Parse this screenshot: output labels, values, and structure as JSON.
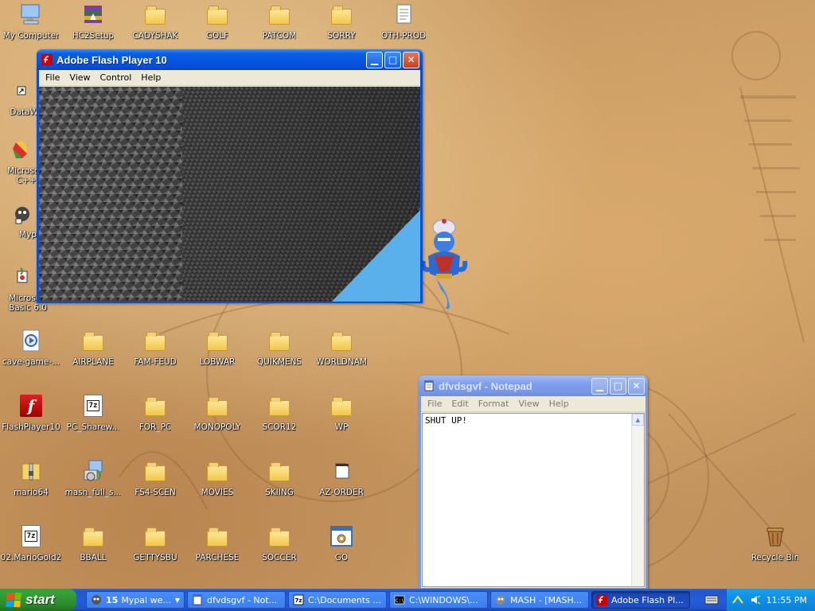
{
  "desktop": {
    "icons": [
      {
        "label": "My Computer",
        "icon": "computer-icon"
      },
      {
        "label": "HC2Setup",
        "icon": "archive-installer-icon"
      },
      {
        "label": "CADYSHAK",
        "icon": "folder-icon"
      },
      {
        "label": "GOLF",
        "icon": "folder-icon"
      },
      {
        "label": "PATCOM",
        "icon": "folder-icon"
      },
      {
        "label": "SORRY",
        "icon": "folder-icon"
      },
      {
        "label": "OTH-PROD",
        "icon": "document-icon"
      },
      {
        "label": "DataWa",
        "icon": "shortcut-icon"
      },
      {
        "label": "Microsoft C++",
        "icon": "visual-cpp-icon"
      },
      {
        "label": "Myp",
        "icon": "mypal-shortcut-icon"
      },
      {
        "label": "Microsoft Basic 6.0",
        "icon": "visual-basic-icon"
      },
      {
        "label": "cave-game-...",
        "icon": "media-file-icon"
      },
      {
        "label": "AIRPLANE",
        "icon": "folder-icon"
      },
      {
        "label": "FAM-FEUD",
        "icon": "folder-icon"
      },
      {
        "label": "LOBWAR",
        "icon": "folder-icon"
      },
      {
        "label": "QUIKMENS",
        "icon": "folder-icon"
      },
      {
        "label": "WORLDNAM",
        "icon": "folder-icon"
      },
      {
        "label": "FlashPlayer10",
        "icon": "flash-player-icon"
      },
      {
        "label": "PC_Sharew...",
        "icon": "7z-archive-icon"
      },
      {
        "label": "FOR_PC",
        "icon": "folder-icon"
      },
      {
        "label": "MONOPOLY",
        "icon": "folder-icon"
      },
      {
        "label": "SCOR12",
        "icon": "folder-icon"
      },
      {
        "label": "WP",
        "icon": "folder-icon"
      },
      {
        "label": "mario64",
        "icon": "zip-archive-icon"
      },
      {
        "label": "mash_full_s...",
        "icon": "installer-icon"
      },
      {
        "label": "FS4-SCEN",
        "icon": "folder-icon"
      },
      {
        "label": "MOVIES",
        "icon": "folder-icon"
      },
      {
        "label": "SKIING",
        "icon": "folder-icon"
      },
      {
        "label": "AZ-ORDER",
        "icon": "file-icon"
      },
      {
        "label": "02.MarioGold2",
        "icon": "7z-archive-icon"
      },
      {
        "label": "BBALL",
        "icon": "folder-icon"
      },
      {
        "label": "GETTYSBU",
        "icon": "folder-icon"
      },
      {
        "label": "PARCHESE",
        "icon": "folder-icon"
      },
      {
        "label": "SOCCER",
        "icon": "folder-icon"
      },
      {
        "label": "GO",
        "icon": "batch-file-icon"
      },
      {
        "label": "Recycle Bin",
        "icon": "recycle-bin-icon"
      }
    ]
  },
  "flash_window": {
    "title": "Adobe Flash Player 10",
    "menu": [
      "File",
      "View",
      "Control",
      "Help"
    ]
  },
  "notepad_window": {
    "title": "dfvdsgvf - Notepad",
    "menu": [
      "File",
      "Edit",
      "Format",
      "View",
      "Help"
    ],
    "content": "SHUT UP!"
  },
  "taskbar": {
    "start_label": "start",
    "tasks": [
      {
        "count": "15",
        "label": "Mypal we...",
        "icon": "mypal-icon",
        "grouped": true
      },
      {
        "label": "dfvdsgvf - Not...",
        "icon": "notepad-icon"
      },
      {
        "label": "C:\\Documents ...",
        "icon": "7z-icon"
      },
      {
        "label": "C:\\WINDOWS\\...",
        "icon": "console-icon"
      },
      {
        "label": "MASH - [MASH...",
        "icon": "mash-icon"
      },
      {
        "label": "Adobe Flash Pl...",
        "icon": "flash-icon",
        "active": true
      }
    ],
    "clock": "11:55 PM"
  },
  "colors": {
    "xp_blue": "#0a4ed3",
    "start_green": "#36a236",
    "tray_blue": "#0f8ee6",
    "flash_sky": "#5ab0ea"
  }
}
